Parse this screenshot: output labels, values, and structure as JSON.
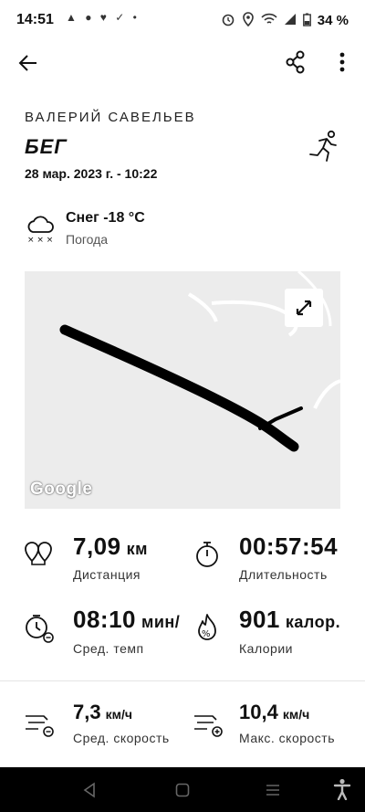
{
  "status_bar": {
    "time": "14:51",
    "left_icons": "▲ ● ♥ ✓ •",
    "battery": "34 %"
  },
  "header": {
    "user_name": "ВАЛЕРИЙ САВЕЛЬЕВ",
    "activity_type": "БЕГ",
    "date": "28 мар. 2023 г. - 10:22"
  },
  "weather": {
    "text": "Снег -18 °C",
    "label": "Погода"
  },
  "map": {
    "logo": "Google",
    "route_color": "#000000",
    "background_color": "#ececec"
  },
  "stats": {
    "distance": {
      "value": "7,09",
      "unit": "км",
      "label": "Дистанция",
      "icon": "distance-pin-icon"
    },
    "duration": {
      "value": "00:57:54",
      "label": "Длительность",
      "icon": "stopwatch-icon"
    },
    "pace": {
      "value": "08:10",
      "unit": "мин/",
      "label": "Сред. темп",
      "icon": "pace-timer-icon"
    },
    "calories": {
      "value": "901",
      "unit": "калор.",
      "label": "Калории",
      "icon": "flame-icon"
    },
    "avg_speed": {
      "value": "7,3",
      "unit": "км/ч",
      "label": "Сред. скорость",
      "icon": "speed-minus-icon"
    },
    "max_speed": {
      "value": "10,4",
      "unit": "км/ч",
      "label": "Макс. скорость",
      "icon": "speed-plus-icon"
    }
  }
}
